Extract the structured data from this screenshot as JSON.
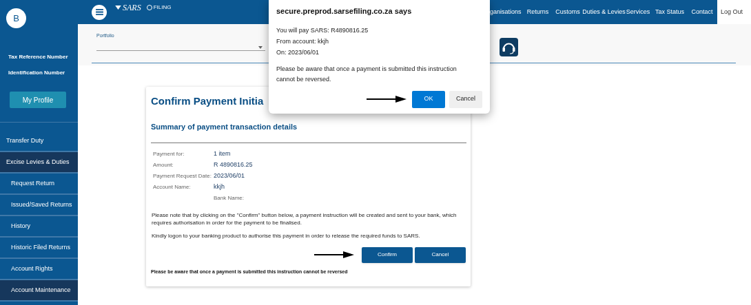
{
  "sidebar": {
    "avatar": "B",
    "tax_reference_label": "Tax Reference Number",
    "identification_label": "Identification Number",
    "profile_button": "My Profile",
    "items": [
      {
        "label": "Transfer Duty",
        "selected": false,
        "expanded": false
      },
      {
        "label": "Excise Levies & Duties",
        "expanded": true,
        "children": [
          {
            "label": "Request Return",
            "selected": false
          },
          {
            "label": "Issued/Saved Returns",
            "selected": false
          },
          {
            "label": "History",
            "selected": false
          },
          {
            "label": "Historic Filed Returns",
            "selected": false
          },
          {
            "label": "Account Rights",
            "selected": false
          },
          {
            "label": "Account Maintenance",
            "selected": true
          }
        ]
      }
    ]
  },
  "header": {
    "logo": "SARS",
    "sub_logo": "FILING",
    "nav": [
      {
        "label": "ganisations",
        "selected": false
      },
      {
        "label": "Returns",
        "selected": false
      },
      {
        "label": "Customs",
        "selected": false
      },
      {
        "label": "Duties & Levies",
        "selected": false
      },
      {
        "label": "Services",
        "selected": false
      },
      {
        "label": "Tax Status",
        "selected": false
      },
      {
        "label": "Contact",
        "selected": false
      },
      {
        "label": "Log Out",
        "selected": true
      }
    ]
  },
  "portfolio": {
    "label": "Portfolio"
  },
  "card": {
    "title": "Confirm Payment Initia",
    "subtitle": "Summary of payment transaction details",
    "details": [
      {
        "label": "Payment for:",
        "value": "1 item"
      },
      {
        "label": "Amount:",
        "value": "R 4890816.25"
      },
      {
        "label": "Payment Request Date:",
        "value": "2023/06/01"
      },
      {
        "label": "Account Name:",
        "value": "kkjh"
      },
      {
        "sub_label": "Bank Name:"
      }
    ],
    "note": "Please note that by clicking on the \"Confirm\" button below, a payment instruction will be created and sent to your bank, which requires authorisation in order for the payment to be finalised.",
    "instruction": "Kindly logon to your banking product to authorise this payment in order to release the required funds to SARS.",
    "buttons": [
      "Confirm",
      "Cancel"
    ],
    "footer": "Please be aware that once a payment is submitted this instruction cannot be reversed"
  },
  "dialog": {
    "title": "secure.preprod.sarsefiling.co.za says",
    "lines": [
      "You will pay SARS: R4890816.25",
      "From account: kkjh",
      "On: 2023/06/01"
    ],
    "message": "Please be aware that once a payment is submitted this instruction cannot be reversed.",
    "ok": "OK",
    "cancel": "Cancel"
  }
}
